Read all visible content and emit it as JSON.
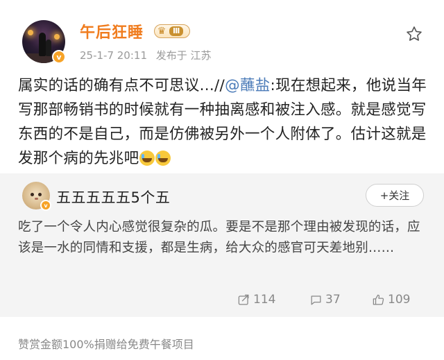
{
  "post": {
    "username": "午后狂睡",
    "level_badge": "Ⅲ",
    "verify_badge": "v",
    "timestamp": "25-1-7 20:11",
    "location": "发布于 江苏",
    "content_before_mention": "属实的话的确有点不可思议...//",
    "mention": "@蘸盐",
    "content_after_mention": ":现在想起来，他说当年写那部畅销书的时候就有一种抽离感和被注入感。就是感觉写东西的不是自己，而是仿佛被另外一个人附体了。估计这就是发那个病的先兆吧",
    "emoji": [
      "crying-emoji",
      "crying-emoji"
    ]
  },
  "repost": {
    "username": "五五五五五5个五",
    "follow_label": "+关注",
    "text": "吃了一个令人内心感觉很复杂的瓜。要是不是那个理由被发现的话，应该是一水的同情和支援，都是生病，给大众的感官可天差地别……",
    "repost_count": "114",
    "comment_count": "37",
    "like_count": "109"
  },
  "footer": {
    "text": "赞赏金额100%捐赠给免费午餐项目"
  },
  "colors": {
    "username": "#f07c1e",
    "mention": "#4b7bb8",
    "repost_bg": "#f4f4f4",
    "badge": "#f7a327"
  }
}
